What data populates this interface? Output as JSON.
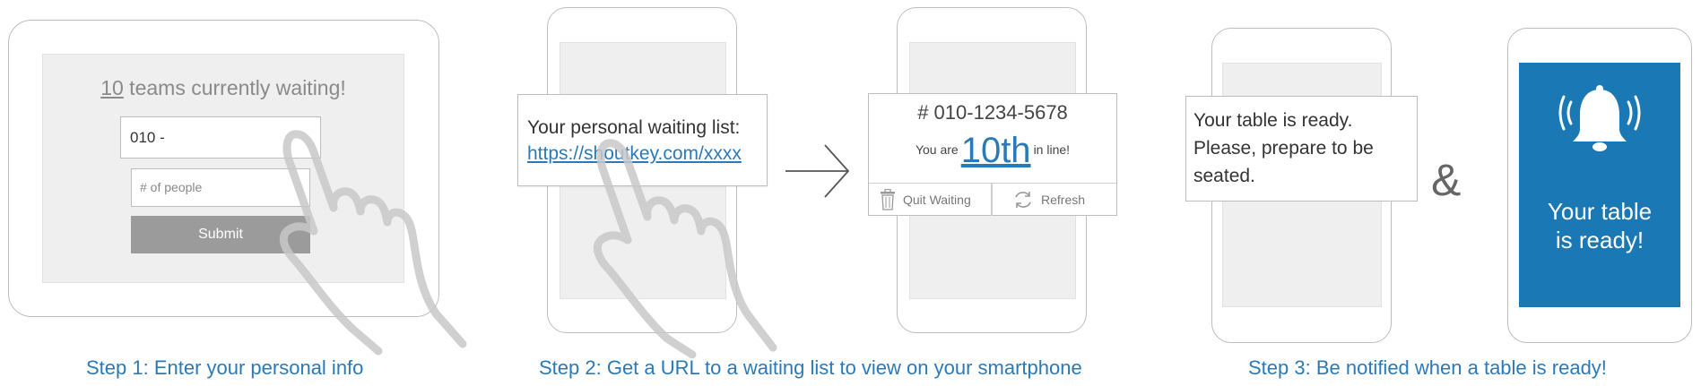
{
  "step1": {
    "waiting_count": "10",
    "waiting_text": " teams currently waiting!",
    "phone_value": "010 -",
    "people_placeholder": "# of people",
    "submit_label": "Submit",
    "caption": "Step 1: Enter your personal info"
  },
  "step2": {
    "url_intro": "Your personal waiting list:",
    "url": "https://shoutkey.com/xxxx",
    "phone_number": "# 010-1234-5678",
    "you_are": "You are",
    "position": "10th",
    "in_line": "in line!",
    "quit_label": "Quit Waiting",
    "refresh_label": "Refresh",
    "caption": "Step 2: Get a URL to a waiting list to view on your smartphone"
  },
  "step3": {
    "ready_line1": "Your table is ready.",
    "ready_line2": "Please, prepare to be",
    "ready_line3": "seated.",
    "ampersand": "&",
    "notify_line1": "Your table",
    "notify_line2": "is ready!",
    "caption": "Step 3: Be notified when a table is ready!"
  },
  "colors": {
    "accent": "#2a7ab8",
    "notification_bg": "#1a78b5",
    "device_border": "#bdbdbd",
    "screen_bg": "#efefef"
  },
  "icons": [
    "hand-pointer-icon",
    "arrow-right-icon",
    "trash-icon",
    "refresh-icon",
    "bell-icon"
  ]
}
